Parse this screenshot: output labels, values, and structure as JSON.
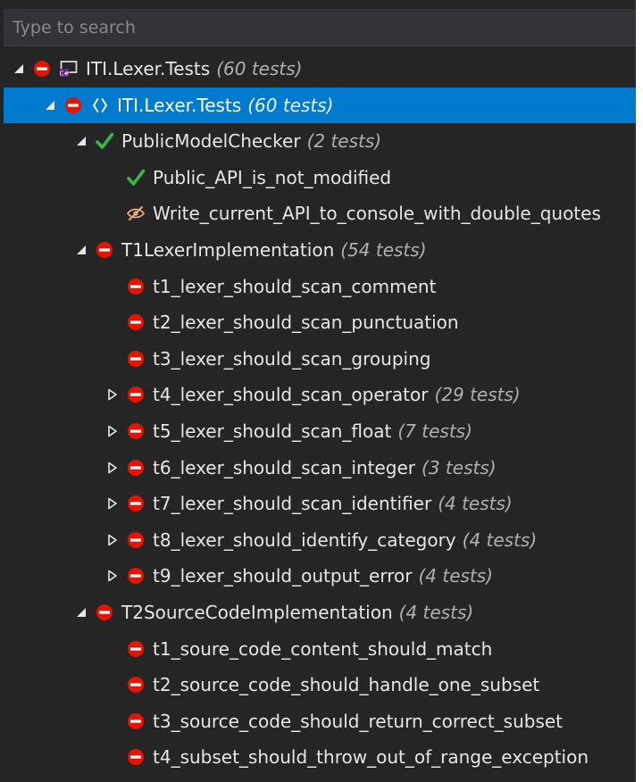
{
  "search": {
    "placeholder": "Type to search"
  },
  "colors": {
    "panel_bg": "#252526",
    "selected_bg": "#007acc",
    "failed": "#e51400",
    "passed": "#39b54a",
    "count_text": "#b0b0b0"
  },
  "tree": [
    {
      "label": "ITI.Lexer.Tests",
      "count": "(60 tests)",
      "status": "failed",
      "icon": "project-icon",
      "depth": 0,
      "arrow": "expanded",
      "selected": false
    },
    {
      "label": "ITI.Lexer.Tests",
      "count": "(60 tests)",
      "status": "failed",
      "icon": "namespace-icon",
      "depth": 1,
      "arrow": "expanded",
      "selected": true
    },
    {
      "label": "PublicModelChecker",
      "count": "(2 tests)",
      "status": "passed",
      "icon": "",
      "depth": 2,
      "arrow": "expanded",
      "selected": false
    },
    {
      "label": "Public_API_is_not_modified",
      "count": "",
      "status": "passed",
      "icon": "",
      "depth": 3,
      "arrow": "none",
      "selected": false
    },
    {
      "label": "Write_current_API_to_console_with_double_quotes",
      "count": "",
      "status": "ignored",
      "icon": "",
      "depth": 3,
      "arrow": "none",
      "selected": false
    },
    {
      "label": "T1LexerImplementation",
      "count": "(54 tests)",
      "status": "failed",
      "icon": "",
      "depth": 2,
      "arrow": "expanded",
      "selected": false
    },
    {
      "label": "t1_lexer_should_scan_comment",
      "count": "",
      "status": "failed",
      "icon": "",
      "depth": 3,
      "arrow": "none",
      "selected": false
    },
    {
      "label": "t2_lexer_should_scan_punctuation",
      "count": "",
      "status": "failed",
      "icon": "",
      "depth": 3,
      "arrow": "none",
      "selected": false
    },
    {
      "label": "t3_lexer_should_scan_grouping",
      "count": "",
      "status": "failed",
      "icon": "",
      "depth": 3,
      "arrow": "none",
      "selected": false
    },
    {
      "label": "t4_lexer_should_scan_operator",
      "count": "(29 tests)",
      "status": "failed",
      "icon": "",
      "depth": 3,
      "arrow": "collapsed",
      "selected": false
    },
    {
      "label": "t5_lexer_should_scan_float",
      "count": "(7 tests)",
      "status": "failed",
      "icon": "",
      "depth": 3,
      "arrow": "collapsed",
      "selected": false
    },
    {
      "label": "t6_lexer_should_scan_integer",
      "count": "(3 tests)",
      "status": "failed",
      "icon": "",
      "depth": 3,
      "arrow": "collapsed",
      "selected": false
    },
    {
      "label": "t7_lexer_should_scan_identifier",
      "count": "(4 tests)",
      "status": "failed",
      "icon": "",
      "depth": 3,
      "arrow": "collapsed",
      "selected": false
    },
    {
      "label": "t8_lexer_should_identify_category",
      "count": "(4 tests)",
      "status": "failed",
      "icon": "",
      "depth": 3,
      "arrow": "collapsed",
      "selected": false
    },
    {
      "label": "t9_lexer_should_output_error",
      "count": "(4 tests)",
      "status": "failed",
      "icon": "",
      "depth": 3,
      "arrow": "collapsed",
      "selected": false
    },
    {
      "label": "T2SourceCodeImplementation",
      "count": "(4 tests)",
      "status": "failed",
      "icon": "",
      "depth": 2,
      "arrow": "expanded",
      "selected": false
    },
    {
      "label": "t1_soure_code_content_should_match",
      "count": "",
      "status": "failed",
      "icon": "",
      "depth": 3,
      "arrow": "none",
      "selected": false
    },
    {
      "label": "t2_source_code_should_handle_one_subset",
      "count": "",
      "status": "failed",
      "icon": "",
      "depth": 3,
      "arrow": "none",
      "selected": false
    },
    {
      "label": "t3_source_code_should_return_correct_subset",
      "count": "",
      "status": "failed",
      "icon": "",
      "depth": 3,
      "arrow": "none",
      "selected": false
    },
    {
      "label": "t4_subset_should_throw_out_of_range_exception",
      "count": "",
      "status": "failed",
      "icon": "",
      "depth": 3,
      "arrow": "none",
      "selected": false
    }
  ]
}
